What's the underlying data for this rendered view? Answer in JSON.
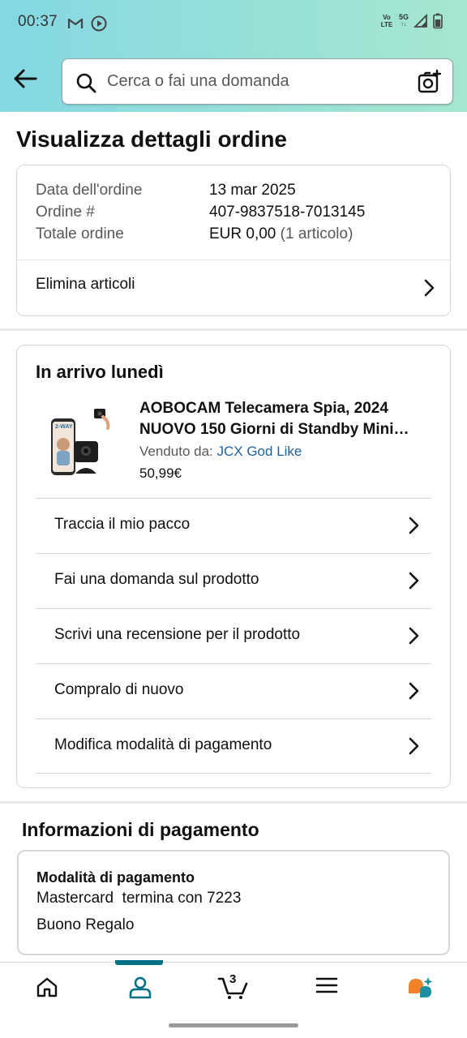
{
  "status_bar": {
    "time": "00:37",
    "icons": [
      "gmail-icon",
      "play-circle-icon"
    ],
    "network_volte_line1": "Vo",
    "network_volte_line2": "LTE",
    "network_5g": "5G",
    "right_icons": [
      "signal-icon",
      "battery-icon"
    ]
  },
  "header": {
    "back_icon": "arrow-left-icon",
    "search_placeholder": "Cerca o fai una domanda",
    "camera_icon": "camera-search-icon",
    "gradient_colors": [
      "#84d8e3",
      "#a6e6cf"
    ]
  },
  "page_title": "Visualizza dettagli ordine",
  "order_summary": {
    "rows": [
      {
        "label": "Data dell'ordine",
        "value": "13 mar 2025",
        "note": ""
      },
      {
        "label": "Ordine #",
        "value": "407-9837518-7013145",
        "note": ""
      },
      {
        "label": "Totale ordine",
        "value": "EUR 0,00",
        "note": "(1 articolo)"
      }
    ],
    "delete_items_label": "Elimina articoli"
  },
  "shipment": {
    "title": "In arrivo lunedì",
    "product": {
      "title_line1": "AOBOCAM Telecamera Spia, 2024",
      "title_line2": "NUOVO 150 Giorni di Standby Mini…",
      "sold_by_label": "Venduto da:",
      "seller": "JCX God Like",
      "price": "50,99€",
      "image_icon": "product-camera-image"
    },
    "actions": [
      {
        "label": "Traccia il mio pacco"
      },
      {
        "label": "Fai una domanda sul prodotto"
      },
      {
        "label": "Scrivi una recensione per il prodotto"
      },
      {
        "label": "Compralo di nuovo"
      },
      {
        "label": "Modifica modalità di pagamento"
      }
    ]
  },
  "payment": {
    "section_title": "Informazioni di pagamento",
    "method_heading": "Modalità di pagamento",
    "method_line": "Mastercard  termina con 7223",
    "gift_card": "Buono Regalo"
  },
  "bottom_nav": {
    "items": [
      "home-icon",
      "account-icon",
      "cart-icon",
      "menu-icon",
      "ai-assistant-icon"
    ],
    "active": "account-icon",
    "cart_count": "3",
    "accent_color": "#007185"
  }
}
